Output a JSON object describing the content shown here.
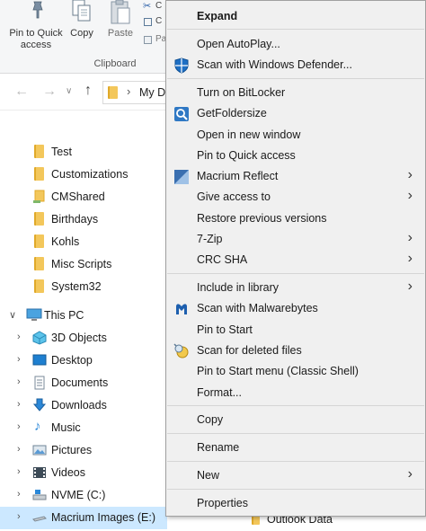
{
  "ribbon": {
    "pin_label": "Pin to Quick access",
    "copy_label": "Copy",
    "paste_label": "Paste",
    "mini_items": [
      "C",
      "C",
      "Pa"
    ],
    "group_label": "Clipboard"
  },
  "nav": {
    "address_text": "My D"
  },
  "tree": {
    "quick_items": [
      "Test",
      "Customizations",
      "CMShared",
      "Birthdays",
      "Kohls",
      "Misc Scripts",
      "System32"
    ],
    "this_pc": "This PC",
    "pc_items": [
      "3D Objects",
      "Desktop",
      "Documents",
      "Downloads",
      "Music",
      "Pictures",
      "Videos",
      "NVME (C:)",
      "Macrium Images (E:)"
    ]
  },
  "right_pane": {
    "outlook_label": "Outlook Data"
  },
  "menu": {
    "items": [
      {
        "label": "Expand",
        "icon": "",
        "submenu": false
      },
      {
        "label": "Open AutoPlay...",
        "icon": "",
        "submenu": false
      },
      {
        "label": "Scan with Windows Defender...",
        "icon": "defender-shield-icon",
        "submenu": false
      },
      {
        "label": "Turn on BitLocker",
        "icon": "",
        "submenu": false
      },
      {
        "label": "GetFoldersize",
        "icon": "getfoldersize-icon",
        "submenu": false
      },
      {
        "label": "Open in new window",
        "icon": "",
        "submenu": false
      },
      {
        "label": "Pin to Quick access",
        "icon": "",
        "submenu": false
      },
      {
        "label": "Macrium Reflect",
        "icon": "macrium-reflect-icon",
        "submenu": true
      },
      {
        "label": "Give access to",
        "icon": "",
        "submenu": true
      },
      {
        "label": "Restore previous versions",
        "icon": "",
        "submenu": false
      },
      {
        "label": "7-Zip",
        "icon": "",
        "submenu": true
      },
      {
        "label": "CRC SHA",
        "icon": "",
        "submenu": true
      },
      {
        "label": "Include in library",
        "icon": "",
        "submenu": true
      },
      {
        "label": "Scan with Malwarebytes",
        "icon": "malwarebytes-icon",
        "submenu": false
      },
      {
        "label": "Pin to Start",
        "icon": "",
        "submenu": false
      },
      {
        "label": "Scan for deleted files",
        "icon": "recovery-scan-icon",
        "submenu": false
      },
      {
        "label": "Pin to Start menu (Classic Shell)",
        "icon": "",
        "submenu": false
      },
      {
        "label": "Format...",
        "icon": "",
        "submenu": false
      },
      {
        "label": "Copy",
        "icon": "",
        "submenu": false
      },
      {
        "label": "Rename",
        "icon": "",
        "submenu": false
      },
      {
        "label": "New",
        "icon": "",
        "submenu": true
      },
      {
        "label": "Properties",
        "icon": "",
        "submenu": false
      }
    ]
  }
}
